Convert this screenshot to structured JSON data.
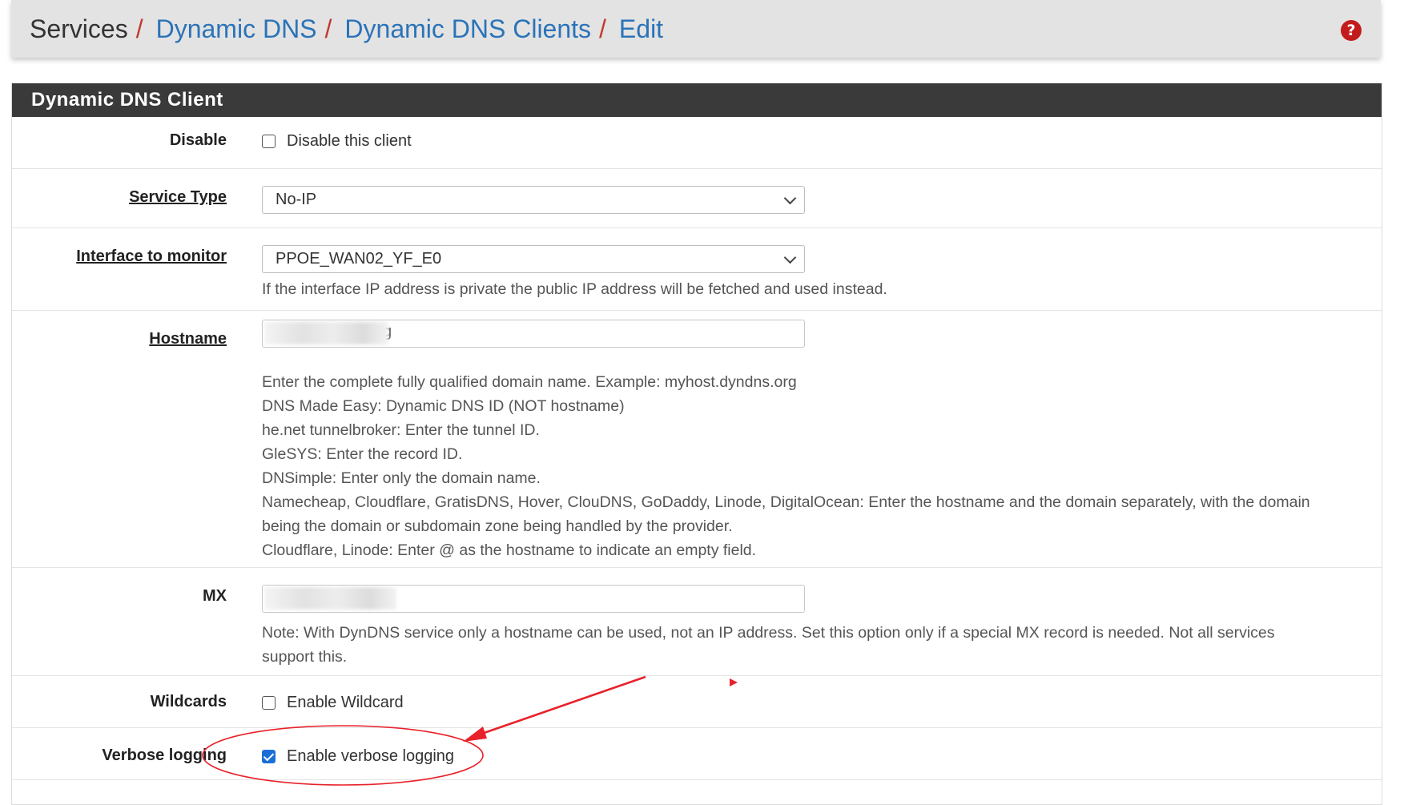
{
  "breadcrumb": {
    "items": [
      {
        "label": "Services",
        "link": false
      },
      {
        "label": "Dynamic DNS",
        "link": true
      },
      {
        "label": "Dynamic DNS Clients",
        "link": true
      },
      {
        "label": "Edit",
        "link": true
      }
    ],
    "separator": "/"
  },
  "help_icon": "question-circle-icon",
  "panel": {
    "title": "Dynamic DNS Client"
  },
  "fields": {
    "disable": {
      "label": "Disable",
      "checkbox_label": "Disable this client",
      "checked": false
    },
    "service_type": {
      "label": "Service Type",
      "value": "No-IP"
    },
    "interface": {
      "label": "Interface to monitor",
      "value": "PPOE_WAN02_YF_E0",
      "help": "If the interface IP address is private the public IP address will be fetched and used instead."
    },
    "hostname": {
      "label": "Hostname",
      "value_visible_fragment": "g",
      "help_lines": [
        "Enter the complete fully qualified domain name. Example: myhost.dyndns.org",
        "DNS Made Easy: Dynamic DNS ID (NOT hostname)",
        "he.net tunnelbroker: Enter the tunnel ID.",
        "GleSYS: Enter the record ID.",
        "DNSimple: Enter only the domain name.",
        "Namecheap, Cloudflare, GratisDNS, Hover, ClouDNS, GoDaddy, Linode, DigitalOcean: Enter the hostname and the domain separately, with the domain",
        "being the domain or subdomain zone being handled by the provider.",
        "Cloudflare, Linode: Enter @ as the hostname to indicate an empty field."
      ]
    },
    "mx": {
      "label": "MX",
      "help_lines": [
        "Note: With DynDNS service only a hostname can be used, not an IP address. Set this option only if a special MX record is needed. Not all services",
        "support this."
      ]
    },
    "wildcards": {
      "label": "Wildcards",
      "checkbox_label": "Enable Wildcard",
      "checked": false
    },
    "verbose": {
      "label": "Verbose logging",
      "checkbox_label": "Enable verbose logging",
      "checked": true
    }
  },
  "colors": {
    "link": "#2b73b8",
    "separator": "#c0392b",
    "header_bar": "#e3e3e3",
    "panel_heading": "#3a3a3a",
    "checkbox_checked": "#1a6fd6",
    "annotation": "#e8212a"
  }
}
